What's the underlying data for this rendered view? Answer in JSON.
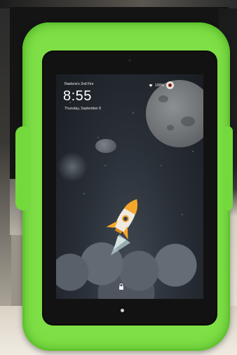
{
  "lockscreen": {
    "owner_name": "Raelens's 2nd Fire",
    "battery_percent": "100%",
    "time": "8:55",
    "date": "Thursday, September 8"
  },
  "icons": {
    "wifi": "wifi-icon",
    "profile": "profile-avatar-icon",
    "lock": "lock-icon",
    "rocket": "rocket-illustration"
  },
  "colors": {
    "case_green": "#7ee046",
    "screen_bg": "#2a3038"
  }
}
